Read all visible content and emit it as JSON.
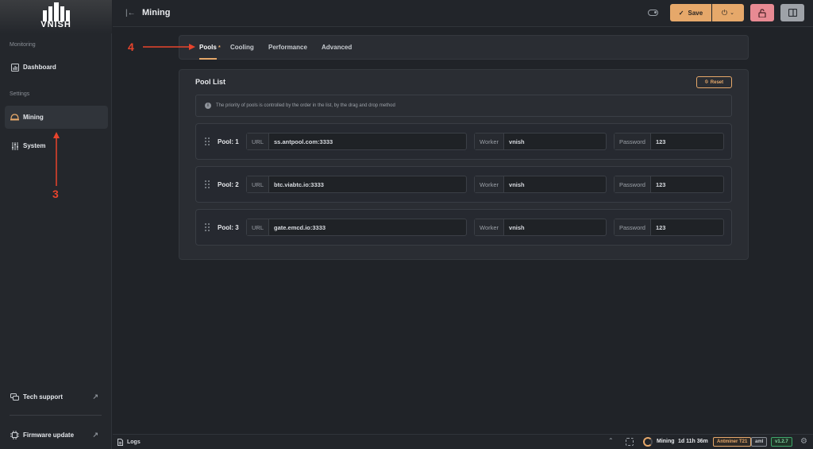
{
  "app": {
    "logo_text": "VNISH"
  },
  "sidebar": {
    "monitoring_label": "Monitoring",
    "settings_label": "Settings",
    "items": [
      {
        "label": "Dashboard",
        "icon": "dashboard-icon"
      },
      {
        "label": "Mining",
        "icon": "mining-helmet-icon",
        "active": true
      },
      {
        "label": "System",
        "icon": "sliders-icon"
      }
    ],
    "bottom": [
      {
        "label": "Tech support",
        "icon": "chat-icon"
      },
      {
        "label": "Firmware update",
        "icon": "chip-icon"
      }
    ]
  },
  "header": {
    "title": "Mining",
    "save_label": "Save"
  },
  "tabs": [
    {
      "label": "Pools",
      "active": true,
      "modified_marker": "*"
    },
    {
      "label": "Cooling"
    },
    {
      "label": "Performance"
    },
    {
      "label": "Advanced"
    }
  ],
  "pool_list": {
    "title": "Pool List",
    "reset_label": "Reset",
    "info": "The priority of pools is controlled by the order in the list, by the drag and drop method",
    "url_prefix": "URL",
    "worker_prefix": "Worker",
    "password_prefix": "Password",
    "pools": [
      {
        "label": "Pool: 1",
        "url": "ss.antpool.com:3333",
        "worker": "vnish",
        "password": "123"
      },
      {
        "label": "Pool: 2",
        "url": "btc.viabtc.io:3333",
        "worker": "vnish",
        "password": "123"
      },
      {
        "label": "Pool: 3",
        "url": "gate.emcd.io:3333",
        "worker": "vnish",
        "password": "123"
      }
    ]
  },
  "annotations": {
    "step_3": "3",
    "step_4": "4"
  },
  "footer": {
    "logs_label": "Logs",
    "status": "Mining",
    "uptime": "1d 11h 36m",
    "model": "Antminer T21",
    "platform": "aml",
    "version": "v1.2.7"
  },
  "colors": {
    "accent": "#e6a86a",
    "danger": "#e88a93",
    "annotation": "#e8442c",
    "version_badge": "#3fa66b"
  }
}
